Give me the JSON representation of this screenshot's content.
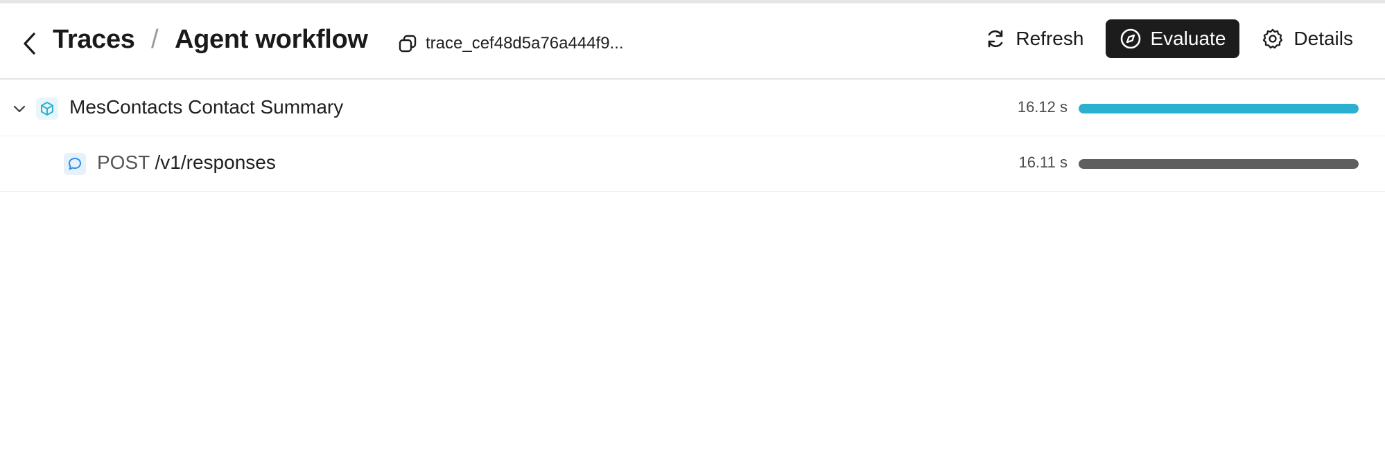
{
  "header": {
    "breadcrumb_root": "Traces",
    "breadcrumb_sep": "/",
    "title": "Agent workflow",
    "trace_id": "trace_cef48d5a76a444f9...",
    "actions": {
      "refresh_label": "Refresh",
      "evaluate_label": "Evaluate",
      "details_label": "Details"
    }
  },
  "spans": [
    {
      "label": "MesContacts Contact Summary",
      "duration": "16.12 s",
      "icon": "cube-icon",
      "bar_fraction": 1.0,
      "bar_color": "#2bb0cf",
      "expanded": true
    },
    {
      "method": "POST",
      "label": "/v1/responses",
      "duration": "16.11 s",
      "icon": "chat-bubble-icon",
      "bar_fraction": 1.0,
      "bar_color": "#5f5f5f"
    }
  ],
  "colors": {
    "accent_cyan": "#2bb0cf",
    "dark_button": "#1c1c1c",
    "chat_icon_blue": "#2b8de6"
  }
}
